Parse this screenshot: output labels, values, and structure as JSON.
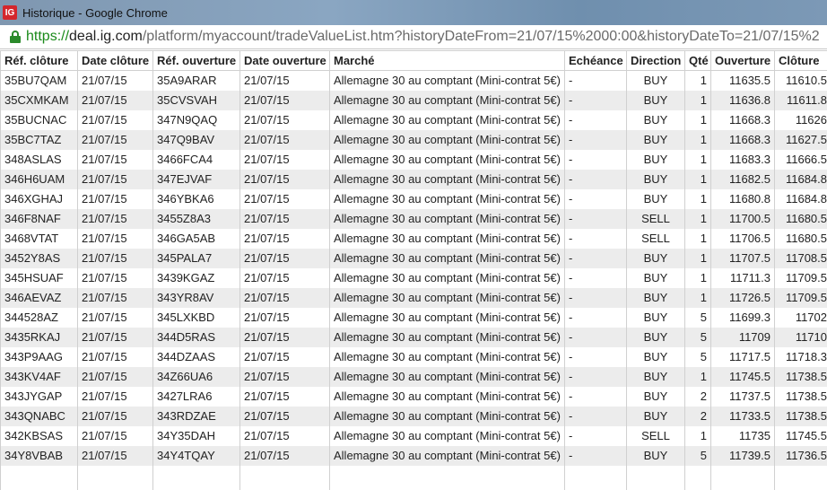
{
  "window": {
    "app_icon_text": "IG",
    "title": "Historique - Google Chrome"
  },
  "address": {
    "scheme": "https://",
    "host": "deal.ig.com",
    "path": "/platform/myaccount/tradeValueList.htm?historyDateFrom=21/07/15%2000:00&historyDateTo=21/07/15%2"
  },
  "colors": {
    "secure_green": "#2b8a2b",
    "row_stripe": "#ececec",
    "app_icon": "#d4262b"
  },
  "table": {
    "headers": [
      "Réf. clôture",
      "Date clôture",
      "Réf. ouverture",
      "Date ouverture",
      "Marché",
      "Echéance",
      "Direction",
      "Qté",
      "Ouverture",
      "Clôture"
    ],
    "rows": [
      [
        "35BU7QAM",
        "21/07/15",
        "35A9ARAR",
        "21/07/15",
        "Allemagne 30 au comptant (Mini-contrat 5€)",
        "-",
        "BUY",
        "1",
        "11635.5",
        "11610.5"
      ],
      [
        "35CXMKAM",
        "21/07/15",
        "35CVSVAH",
        "21/07/15",
        "Allemagne 30 au comptant (Mini-contrat 5€)",
        "-",
        "BUY",
        "1",
        "11636.8",
        "11611.8"
      ],
      [
        "35BUCNAC",
        "21/07/15",
        "347N9QAQ",
        "21/07/15",
        "Allemagne 30 au comptant (Mini-contrat 5€)",
        "-",
        "BUY",
        "1",
        "11668.3",
        "11626"
      ],
      [
        "35BC7TAZ",
        "21/07/15",
        "347Q9BAV",
        "21/07/15",
        "Allemagne 30 au comptant (Mini-contrat 5€)",
        "-",
        "BUY",
        "1",
        "11668.3",
        "11627.5"
      ],
      [
        "348ASLAS",
        "21/07/15",
        "3466FCA4",
        "21/07/15",
        "Allemagne 30 au comptant (Mini-contrat 5€)",
        "-",
        "BUY",
        "1",
        "11683.3",
        "11666.5"
      ],
      [
        "346H6UAM",
        "21/07/15",
        "347EJVAF",
        "21/07/15",
        "Allemagne 30 au comptant (Mini-contrat 5€)",
        "-",
        "BUY",
        "1",
        "11682.5",
        "11684.8"
      ],
      [
        "346XGHAJ",
        "21/07/15",
        "346YBKA6",
        "21/07/15",
        "Allemagne 30 au comptant (Mini-contrat 5€)",
        "-",
        "BUY",
        "1",
        "11680.8",
        "11684.8"
      ],
      [
        "346F8NAF",
        "21/07/15",
        "3455Z8A3",
        "21/07/15",
        "Allemagne 30 au comptant (Mini-contrat 5€)",
        "-",
        "SELL",
        "1",
        "11700.5",
        "11680.5"
      ],
      [
        "3468VTAT",
        "21/07/15",
        "346GA5AB",
        "21/07/15",
        "Allemagne 30 au comptant (Mini-contrat 5€)",
        "-",
        "SELL",
        "1",
        "11706.5",
        "11680.5"
      ],
      [
        "3452Y8AS",
        "21/07/15",
        "345PALA7",
        "21/07/15",
        "Allemagne 30 au comptant (Mini-contrat 5€)",
        "-",
        "BUY",
        "1",
        "11707.5",
        "11708.5"
      ],
      [
        "345HSUAF",
        "21/07/15",
        "3439KGAZ",
        "21/07/15",
        "Allemagne 30 au comptant (Mini-contrat 5€)",
        "-",
        "BUY",
        "1",
        "11711.3",
        "11709.5"
      ],
      [
        "346AEVAZ",
        "21/07/15",
        "343YR8AV",
        "21/07/15",
        "Allemagne 30 au comptant (Mini-contrat 5€)",
        "-",
        "BUY",
        "1",
        "11726.5",
        "11709.5"
      ],
      [
        "344528AZ",
        "21/07/15",
        "345LXKBD",
        "21/07/15",
        "Allemagne 30 au comptant (Mini-contrat 5€)",
        "-",
        "BUY",
        "5",
        "11699.3",
        "11702"
      ],
      [
        "3435RKAJ",
        "21/07/15",
        "344D5RAS",
        "21/07/15",
        "Allemagne 30 au comptant (Mini-contrat 5€)",
        "-",
        "BUY",
        "5",
        "11709",
        "11710"
      ],
      [
        "343P9AAG",
        "21/07/15",
        "344DZAAS",
        "21/07/15",
        "Allemagne 30 au comptant (Mini-contrat 5€)",
        "-",
        "BUY",
        "5",
        "11717.5",
        "11718.3"
      ],
      [
        "343KV4AF",
        "21/07/15",
        "34Z66UA6",
        "21/07/15",
        "Allemagne 30 au comptant (Mini-contrat 5€)",
        "-",
        "BUY",
        "1",
        "11745.5",
        "11738.5"
      ],
      [
        "343JYGAP",
        "21/07/15",
        "3427LRA6",
        "21/07/15",
        "Allemagne 30 au comptant (Mini-contrat 5€)",
        "-",
        "BUY",
        "2",
        "11737.5",
        "11738.5"
      ],
      [
        "343QNABC",
        "21/07/15",
        "343RDZAE",
        "21/07/15",
        "Allemagne 30 au comptant (Mini-contrat 5€)",
        "-",
        "BUY",
        "2",
        "11733.5",
        "11738.5"
      ],
      [
        "342KBSAS",
        "21/07/15",
        "34Y35DAH",
        "21/07/15",
        "Allemagne 30 au comptant (Mini-contrat 5€)",
        "-",
        "SELL",
        "1",
        "11735",
        "11745.5"
      ],
      [
        "34Y8VBAB",
        "21/07/15",
        "34Y4TQAY",
        "21/07/15",
        "Allemagne 30 au comptant (Mini-contrat 5€)",
        "-",
        "BUY",
        "5",
        "11739.5",
        "11736.5"
      ]
    ]
  }
}
